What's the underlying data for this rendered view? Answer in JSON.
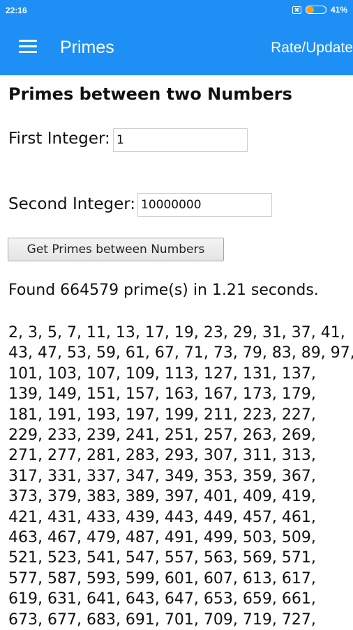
{
  "status_bar": {
    "time": "22:16",
    "battery_percent": "41%",
    "battery_level": 0.41
  },
  "app_bar": {
    "title": "Primes",
    "action": "Rate/Update"
  },
  "page": {
    "heading": "Primes between two Numbers",
    "first_label": "First Integer:",
    "first_value": "1",
    "second_label": "Second Integer:",
    "second_value": "10000000",
    "button_label": "Get Primes between Numbers",
    "result_text": "Found 664579 prime(s) in 1.21 seconds."
  },
  "primes_lines": [
    "2, 3, 5, 7, 11, 13, 17, 19, 23, 29, 31, 37, 41,",
    "43, 47, 53, 59, 61, 67, 71, 73, 79, 83, 89, 97,",
    "101, 103, 107, 109, 113, 127, 131, 137,",
    "139, 149, 151, 157, 163, 167, 173, 179,",
    "181, 191, 193, 197, 199, 211, 223, 227,",
    "229, 233, 239, 241, 251, 257, 263, 269,",
    "271, 277, 281, 283, 293, 307, 311, 313,",
    "317, 331, 337, 347, 349, 353, 359, 367,",
    "373, 379, 383, 389, 397, 401, 409, 419,",
    "421, 431, 433, 439, 443, 449, 457, 461,",
    "463, 467, 479, 487, 491, 499, 503, 509,",
    "521, 523, 541, 547, 557, 563, 569, 571,",
    "577, 587, 593, 599, 601, 607, 613, 617,",
    "619, 631, 641, 643, 647, 653, 659, 661,",
    "673, 677, 683, 691, 701, 709, 719, 727,"
  ]
}
